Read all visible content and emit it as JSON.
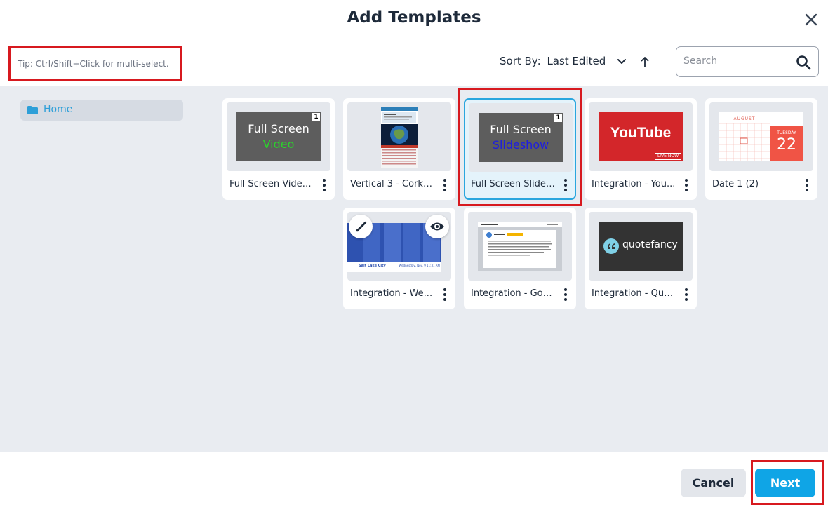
{
  "dialog": {
    "title": "Add Templates",
    "tip": "Tip: Ctrl/Shift+Click for multi-select."
  },
  "toolbar": {
    "sort_label": "Sort By:",
    "sort_value": "Last Edited",
    "search_placeholder": "Search"
  },
  "sidebar": {
    "folders": [
      {
        "label": "Home",
        "icon": "folder-icon"
      }
    ]
  },
  "templates": [
    {
      "name": "Full Screen Video ...",
      "thumb_line1": "Full Screen",
      "thumb_line2": "Video",
      "badge": "1"
    },
    {
      "name": "Vertical 3 - Corkb..."
    },
    {
      "name": "Full Screen Slides...",
      "thumb_line1": "Full Screen",
      "thumb_line2": "Slideshow",
      "badge": "1",
      "selected": true
    },
    {
      "name": "Integration - You...",
      "thumb_logo": "YouTube",
      "thumb_tag": "LIVE NOW"
    },
    {
      "name": "Date 1 (2)",
      "thumb_month": "AUGUST",
      "thumb_weekday": "TUESDAY",
      "thumb_day": "22"
    },
    {
      "name": "Integration - We...",
      "thumb_city": "Salt Lake City",
      "thumb_date": "Wednesday, Nov. 9  11:31 AM"
    },
    {
      "name": "Integration - Goo..."
    },
    {
      "name": "Integration - Quo...",
      "thumb_logo": "quotefancy"
    }
  ],
  "footer": {
    "cancel_label": "Cancel",
    "next_label": "Next"
  },
  "colors": {
    "accent": "#0fa5e6",
    "highlight_frame": "#d7191f",
    "body_bg": "#e9ecf1"
  }
}
